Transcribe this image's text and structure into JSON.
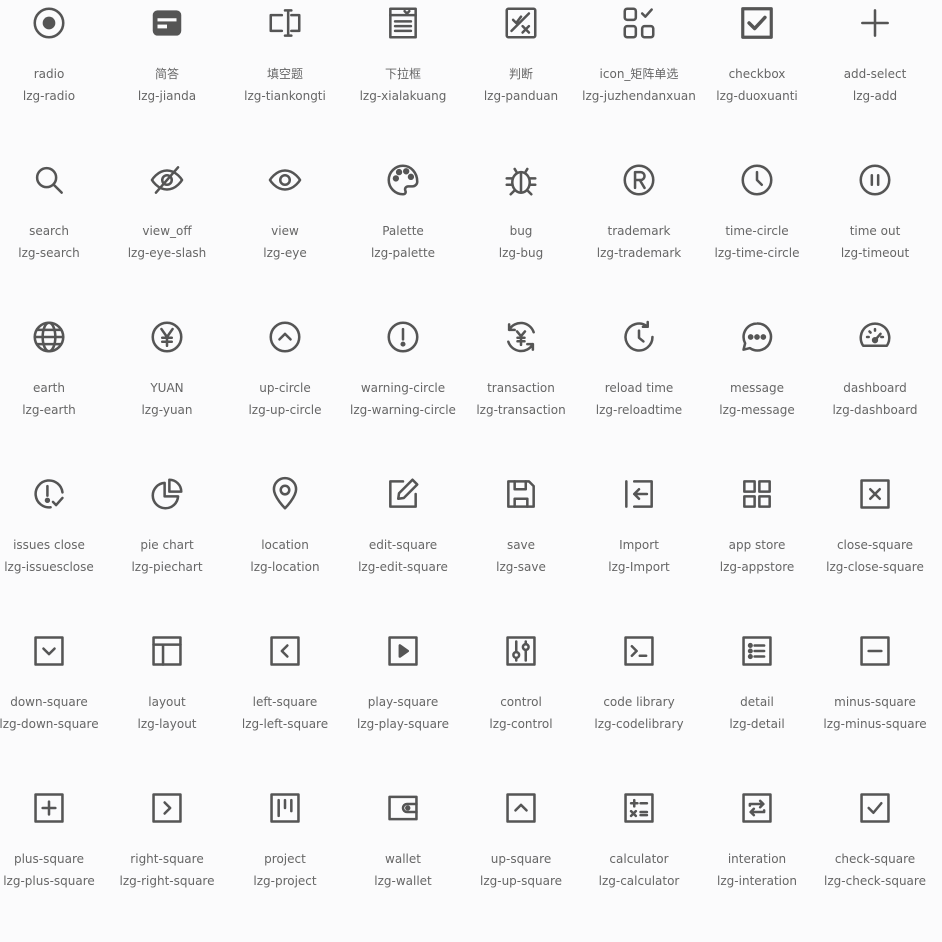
{
  "icons": [
    {
      "label": "radio",
      "code": "lzg-radio",
      "icon": "radio-icon"
    },
    {
      "label": "简答",
      "code": "lzg-jianda",
      "icon": "short-answer-icon"
    },
    {
      "label": "填空题",
      "code": "lzg-tiankongti",
      "icon": "fill-blank-icon"
    },
    {
      "label": "下拉框",
      "code": "lzg-xialakuang",
      "icon": "dropdown-icon"
    },
    {
      "label": "判断",
      "code": "lzg-panduan",
      "icon": "judge-icon"
    },
    {
      "label": "icon_矩阵单选",
      "code": "lzg-juzhendanxuan",
      "icon": "matrix-single-select-icon"
    },
    {
      "label": "checkbox",
      "code": "lzg-duoxuanti",
      "icon": "checkbox-icon"
    },
    {
      "label": "add-select",
      "code": "lzg-add",
      "icon": "add-icon"
    },
    {
      "label": "search",
      "code": "lzg-search",
      "icon": "search-icon"
    },
    {
      "label": "view_off",
      "code": "lzg-eye-slash",
      "icon": "eye-slash-icon"
    },
    {
      "label": "view",
      "code": "lzg-eye",
      "icon": "eye-icon"
    },
    {
      "label": "Palette",
      "code": "lzg-palette",
      "icon": "palette-icon"
    },
    {
      "label": "bug",
      "code": "lzg-bug",
      "icon": "bug-icon"
    },
    {
      "label": "trademark",
      "code": "lzg-trademark",
      "icon": "trademark-icon"
    },
    {
      "label": "time-circle",
      "code": "lzg-time-circle",
      "icon": "time-circle-icon"
    },
    {
      "label": "time out",
      "code": "lzg-timeout",
      "icon": "timeout-icon"
    },
    {
      "label": "earth",
      "code": "lzg-earth",
      "icon": "earth-icon"
    },
    {
      "label": "YUAN",
      "code": "lzg-yuan",
      "icon": "yuan-icon"
    },
    {
      "label": "up-circle",
      "code": "lzg-up-circle",
      "icon": "up-circle-icon"
    },
    {
      "label": "warning-circle",
      "code": "lzg-warning-circle",
      "icon": "warning-circle-icon"
    },
    {
      "label": "transaction",
      "code": "lzg-transaction",
      "icon": "transaction-icon"
    },
    {
      "label": "reload time",
      "code": "lzg-reloadtime",
      "icon": "reload-time-icon"
    },
    {
      "label": "message",
      "code": "lzg-message",
      "icon": "message-icon"
    },
    {
      "label": "dashboard",
      "code": "lzg-dashboard",
      "icon": "dashboard-icon"
    },
    {
      "label": "issues close",
      "code": "lzg-issuesclose",
      "icon": "issues-close-icon"
    },
    {
      "label": "pie chart",
      "code": "lzg-piechart",
      "icon": "pie-chart-icon"
    },
    {
      "label": "location",
      "code": "lzg-location",
      "icon": "location-icon"
    },
    {
      "label": "edit-square",
      "code": "lzg-edit-square",
      "icon": "edit-square-icon"
    },
    {
      "label": "save",
      "code": "lzg-save",
      "icon": "save-icon"
    },
    {
      "label": "Import",
      "code": "lzg-Import",
      "icon": "import-icon"
    },
    {
      "label": "app store",
      "code": "lzg-appstore",
      "icon": "app-store-icon"
    },
    {
      "label": "close-square",
      "code": "lzg-close-square",
      "icon": "close-square-icon"
    },
    {
      "label": "down-square",
      "code": "lzg-down-square",
      "icon": "down-square-icon"
    },
    {
      "label": "layout",
      "code": "lzg-layout",
      "icon": "layout-icon"
    },
    {
      "label": "left-square",
      "code": "lzg-left-square",
      "icon": "left-square-icon"
    },
    {
      "label": "play-square",
      "code": "lzg-play-square",
      "icon": "play-square-icon"
    },
    {
      "label": "control",
      "code": "lzg-control",
      "icon": "control-icon"
    },
    {
      "label": "code library",
      "code": "lzg-codelibrary",
      "icon": "code-library-icon"
    },
    {
      "label": "detail",
      "code": "lzg-detail",
      "icon": "detail-icon"
    },
    {
      "label": "minus-square",
      "code": "lzg-minus-square",
      "icon": "minus-square-icon"
    },
    {
      "label": "plus-square",
      "code": "lzg-plus-square",
      "icon": "plus-square-icon"
    },
    {
      "label": "right-square",
      "code": "lzg-right-square",
      "icon": "right-square-icon"
    },
    {
      "label": "project",
      "code": "lzg-project",
      "icon": "project-icon"
    },
    {
      "label": "wallet",
      "code": "lzg-wallet",
      "icon": "wallet-icon"
    },
    {
      "label": "up-square",
      "code": "lzg-up-square",
      "icon": "up-square-icon"
    },
    {
      "label": "calculator",
      "code": "lzg-calculator",
      "icon": "calculator-icon"
    },
    {
      "label": "interation",
      "code": "lzg-interation",
      "icon": "interation-icon"
    },
    {
      "label": "check-square",
      "code": "lzg-check-square",
      "icon": "check-square-icon"
    }
  ],
  "colors": {
    "icon": "#555555",
    "text": "#666666",
    "background": "#fbfbfc"
  }
}
